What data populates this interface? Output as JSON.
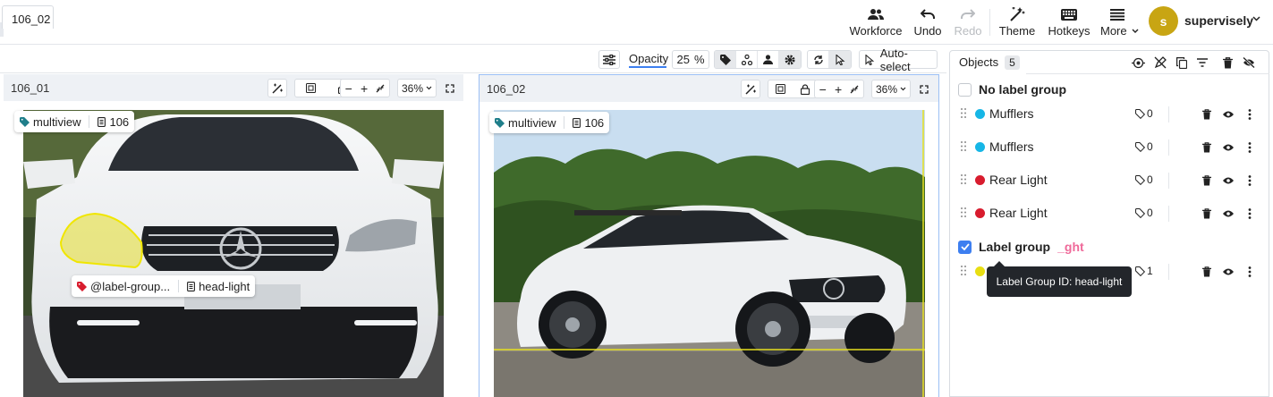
{
  "topbar": {
    "workforce": "Workforce",
    "undo": "Undo",
    "redo": "Redo",
    "theme": "Theme",
    "hotkeys": "Hotkeys",
    "more": "More",
    "user_initial": "s",
    "username": "supervisely"
  },
  "tabs": [
    {
      "label": "106_02"
    }
  ],
  "view_options": {
    "opacity_label": "Opacity",
    "opacity_value": "25",
    "opacity_unit": "%",
    "autoselect_label": "Auto-select"
  },
  "panels": [
    {
      "title": "106_01",
      "zoom": "36%",
      "tag_multiview": "multiview",
      "tag_value": "106",
      "label_group_tag": "@label-group...",
      "label_group_value": "head-light"
    },
    {
      "title": "106_02",
      "zoom": "36%",
      "tag_multiview": "multiview",
      "tag_value": "106"
    }
  ],
  "objects_panel": {
    "tab_label": "Objects",
    "count": "5",
    "groups": [
      {
        "label": "No label group",
        "checked": false,
        "objects": [
          {
            "name": "Mufflers",
            "color": "#16b6e6",
            "tags": "0"
          },
          {
            "name": "Mufflers",
            "color": "#16b6e6",
            "tags": "0"
          },
          {
            "name": "Rear Light",
            "color": "#d81c2e",
            "tags": "0"
          },
          {
            "name": "Rear Light",
            "color": "#d81c2e",
            "tags": "0"
          }
        ]
      },
      {
        "label": "Label group",
        "suffix": "ght",
        "checked": true,
        "objects": [
          {
            "name": "",
            "color": "#e8de12",
            "tags": "1"
          }
        ]
      }
    ],
    "tooltip": "Label Group ID: head-light"
  },
  "colors": {
    "accent": "#3d7ff0",
    "label_group_highlight": "#e6e04a",
    "tooltip_bg": "#23262b"
  }
}
